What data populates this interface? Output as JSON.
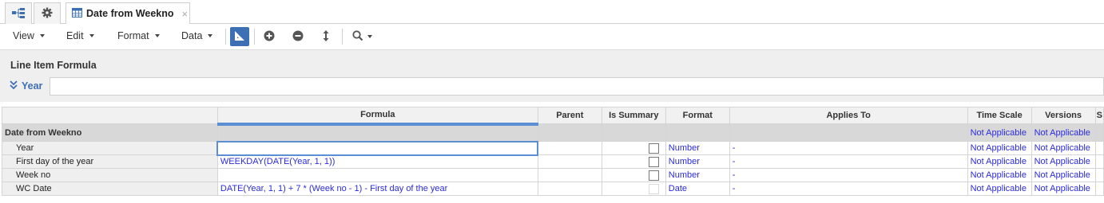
{
  "tabs": {
    "active_tab_label": "Date from Weekno",
    "close_glyph": "×",
    "icons": [
      "hierarchy-icon",
      "gear-icon",
      "grid-icon"
    ]
  },
  "toolbar": {
    "menus": [
      "View",
      "Edit",
      "Format",
      "Data"
    ],
    "buttons": [
      "blueprint-icon",
      "add-icon",
      "remove-icon",
      "move-icon",
      "search-icon"
    ],
    "accent_color": "#3d6fb5"
  },
  "formula_bar": {
    "title": "Line Item Formula",
    "current_line_item": "Year",
    "value": ""
  },
  "grid": {
    "columns": [
      "Formula",
      "Parent",
      "Is Summary",
      "Format",
      "Applies To",
      "Time Scale",
      "Versions",
      "S"
    ],
    "group": {
      "name": "Date from Weekno",
      "time_scale": "Not Applicable",
      "versions": "Not Applicable"
    },
    "rows": [
      {
        "name": "Year",
        "formula": "",
        "is_summary": false,
        "format": "Number",
        "applies_to": "-",
        "time_scale": "Not Applicable",
        "versions": "Not Applicable"
      },
      {
        "name": "First day of the year",
        "formula": "WEEKDAY(DATE(Year, 1, 1))",
        "is_summary": false,
        "format": "Number",
        "applies_to": "-",
        "time_scale": "Not Applicable",
        "versions": "Not Applicable"
      },
      {
        "name": "Week no",
        "formula": "",
        "is_summary": false,
        "format": "Number",
        "applies_to": "-",
        "time_scale": "Not Applicable",
        "versions": "Not Applicable"
      },
      {
        "name": "WC Date",
        "formula": "DATE(Year, 1, 1) + 7 * (Week no - 1) - First day of the year",
        "is_summary": false,
        "format": "Date",
        "applies_to": "-",
        "time_scale": "Not Applicable",
        "versions": "Not Applicable"
      }
    ]
  }
}
